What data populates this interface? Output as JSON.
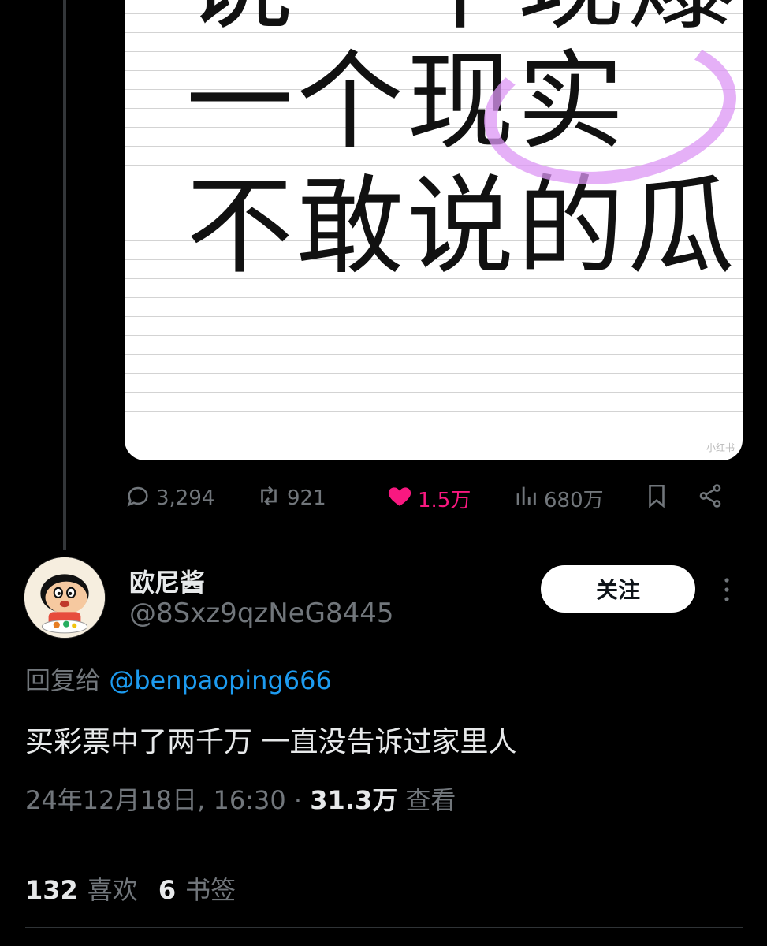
{
  "media": {
    "lines": [
      "说一个现爆",
      "一个现实",
      "不敢说的瓜"
    ],
    "watermark": "小红书"
  },
  "actions": {
    "replies": "3,294",
    "retweets": "921",
    "likes": "1.5万",
    "views": "680万"
  },
  "author": {
    "display_name": "欧尼酱",
    "handle": "@8Sxz9qzNeG8445",
    "follow_label": "关注"
  },
  "reply": {
    "prefix": "回复给",
    "mention": "@benpaoping666"
  },
  "tweet": {
    "text": "买彩票中了两千万 一直没告诉过家里人",
    "date": "24年12月18日, 16:30",
    "views_count": "31.3万",
    "views_label": "查看"
  },
  "stats": {
    "likes_count": "132",
    "likes_label": "喜欢",
    "bookmarks_count": "6",
    "bookmarks_label": "书签"
  },
  "colors": {
    "background": "#000000",
    "like_pink": "#f91880",
    "mention_blue": "#1d9bf0",
    "muted": "#71767b"
  }
}
